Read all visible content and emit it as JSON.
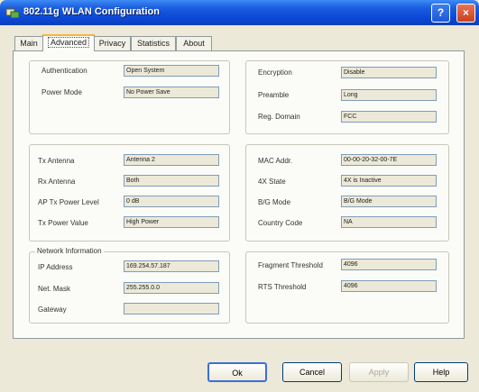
{
  "window": {
    "title": "802.11g WLAN Configuration"
  },
  "tabs": [
    {
      "label": "Main"
    },
    {
      "label": "Advanced"
    },
    {
      "label": "Privacy"
    },
    {
      "label": "Statistics"
    },
    {
      "label": "About"
    }
  ],
  "security": {
    "auth_label": "Authentication",
    "auth_value": "Open System",
    "power_label": "Power Mode",
    "power_value": "No Power Save"
  },
  "radio": {
    "enc_label": "Encryption",
    "enc_value": "Disable",
    "pre_label": "Preamble",
    "pre_value": "Long",
    "reg_label": "Reg. Domain",
    "reg_value": "FCC"
  },
  "antenna": {
    "tx_label": "Tx Antenna",
    "tx_value": "Antenna 2",
    "rx_label": "Rx Antenna",
    "rx_value": "Both",
    "ap_label": "AP Tx Power Level",
    "ap_value": "0 dB",
    "txp_label": "Tx Power Value",
    "txp_value": "High Power"
  },
  "device": {
    "mac_label": "MAC Addr.",
    "mac_value": "00-00-20-32-00-7E",
    "state_label": "4X State",
    "state_value": "4X is Inactive",
    "mode_label": "B/G Mode",
    "mode_value": "B/G Mode",
    "cc_label": "Country Code",
    "cc_value": "NA"
  },
  "network": {
    "title": "Network Information",
    "ip_label": "IP Address",
    "ip_value": "169.254.57.187",
    "mask_label": "Net. Mask",
    "mask_value": "255.255.0.0",
    "gw_label": "Gateway",
    "gw_value": ""
  },
  "thresholds": {
    "frag_label": "Fragment Threshold",
    "frag_value": "4096",
    "rts_label": "RTS Threshold",
    "rts_value": "4096"
  },
  "buttons": {
    "ok": "Ok",
    "cancel": "Cancel",
    "apply": "Apply",
    "help": "Help"
  },
  "colors": {
    "titlebar": "#0a48d8",
    "dialog": "#ece9d8",
    "panel": "#fbfbf8",
    "active_tab": "#f5b542"
  }
}
